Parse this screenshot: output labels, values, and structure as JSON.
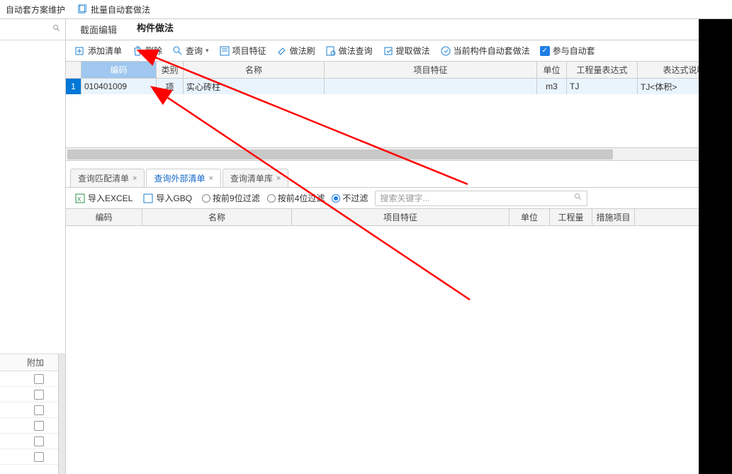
{
  "top_menu": {
    "item1": "自动套方案维护",
    "item2": "批量自动套做法"
  },
  "tabs1": {
    "t1": "截面编辑",
    "t2": "构件做法"
  },
  "toolbar": {
    "add_list": "添加清单",
    "delete": "删除",
    "query": "查询",
    "item_feature": "项目特征",
    "method_brush": "做法刷",
    "method_query": "做法查询",
    "extract_method": "提取做法",
    "current_auto": "当前构件自动套做法",
    "join_auto": "参与自动套"
  },
  "grid1": {
    "headers": {
      "code": "编码",
      "cat": "类别",
      "name": "名称",
      "feat": "项目特征",
      "unit": "单位",
      "expr": "工程量表达式",
      "exprdesc": "表达式说明"
    },
    "row1": {
      "idx": "1",
      "code": "010401009",
      "cat": "项",
      "name": "实心砖柱",
      "feat": "",
      "unit": "m3",
      "expr": "TJ",
      "exprdesc": "TJ<体积>"
    }
  },
  "tabs2": {
    "t1": "查询匹配清单",
    "t2": "查询外部清单",
    "t3": "查询清单库"
  },
  "toolbar2": {
    "import_excel": "导入EXCEL",
    "import_gbq": "导入GBQ",
    "filter9": "按前9位过滤",
    "filter4": "按前4位过滤",
    "nofilter": "不过滤",
    "search_placeholder": "搜索关键字..."
  },
  "grid2": {
    "headers": {
      "code": "编码",
      "name": "名称",
      "feat": "项目特征",
      "unit": "单位",
      "eng": "工程量",
      "meas": "措施项目"
    }
  },
  "left": {
    "attach": "附加"
  }
}
